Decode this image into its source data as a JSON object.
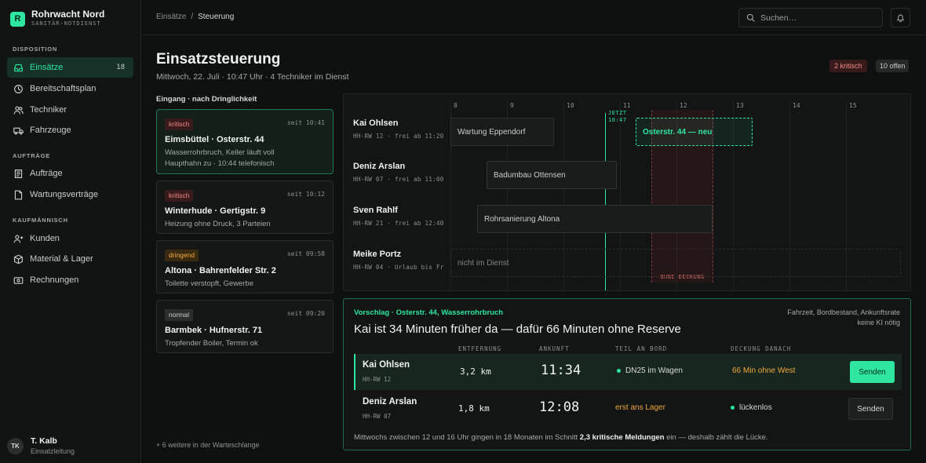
{
  "brand": {
    "initial": "R",
    "name": "Rohrwacht Nord",
    "subtitle": "SANITÄR-NOTDIENST"
  },
  "sidebar": {
    "sections": [
      {
        "label": "DISPOSITION"
      },
      {
        "label": "AUFTRÄGE"
      },
      {
        "label": "KAUFMÄNNISCH"
      }
    ],
    "items": [
      {
        "label": "Einsätze",
        "icon": "inbox-icon",
        "count": "18",
        "active": true
      },
      {
        "label": "Bereitschaftsplan",
        "icon": "clock-icon"
      },
      {
        "label": "Techniker",
        "icon": "users-icon"
      },
      {
        "label": "Fahrzeuge",
        "icon": "truck-icon"
      },
      {
        "label": "Aufträge",
        "icon": "document-icon"
      },
      {
        "label": "Wartungsverträge",
        "icon": "contract-icon"
      },
      {
        "label": "Kunden",
        "icon": "user-icon"
      },
      {
        "label": "Material & Lager",
        "icon": "box-icon"
      },
      {
        "label": "Rechnungen",
        "icon": "invoice-icon"
      }
    ],
    "user": {
      "initials": "TK",
      "name": "T. Kalb",
      "role": "Einsatzleitung"
    }
  },
  "topbar": {
    "breadcrumb": [
      "Einsätze",
      "/",
      "Steuerung"
    ],
    "search_placeholder": "Suchen…"
  },
  "header": {
    "title": "Einsatzsteuerung",
    "subtitle": "Mittwoch, 22. Juli · 10:47 Uhr · 4 Techniker im Dienst",
    "badge_critical": "2 kritisch",
    "badge_open": "10 offen"
  },
  "queue": {
    "label": "Eingang · nach Dringlichkeit",
    "cards": [
      {
        "tag": "kritisch",
        "time": "seit 10:41",
        "title": "Eimsbüttel · Osterstr. 44",
        "desc1": "Wasserrohrbruch, Keller läuft voll",
        "desc2": "Haupthahn zu · 10:44 telefonisch"
      },
      {
        "tag": "kritisch",
        "time": "seit 10:12",
        "title": "Winterhude · Gertigstr. 9",
        "desc1": "Heizung ohne Druck, 3 Parteien"
      },
      {
        "tag": "dringend",
        "time": "seit 09:58",
        "title": "Altona · Bahrenfelder Str. 2",
        "desc1": "Toilette verstopft, Gewerbe"
      },
      {
        "tag": "normal",
        "time": "seit 09:20",
        "title": "Barmbek · Hufnerstr. 71",
        "desc1": "Tropfender Boiler, Termin ok"
      }
    ],
    "more": "+ 6 weitere in der Warteschlange"
  },
  "timeline": {
    "hours": [
      "8",
      "9",
      "10",
      "11",
      "12",
      "13",
      "14",
      "15"
    ],
    "now_label1": "JETZT",
    "now_label2": "10:47",
    "gap_label": "OHNE DECKUNG",
    "rows": [
      {
        "name": "Kai Ohlsen",
        "meta": "HH-RW 12 · frei ab 11:20",
        "block": "Wartung Eppendorf",
        "new_block": "Osterstr. 44 — neu"
      },
      {
        "name": "Deniz Arslan",
        "meta": "HH-RW 07 · frei ab 11:00",
        "block": "Badumbau Ottensen"
      },
      {
        "name": "Sven Rahlf",
        "meta": "HH-RW 21 · frei ab 12:40",
        "block": "Rohrsanierung Altona"
      },
      {
        "name": "Meike Portz",
        "meta": "HH-RW 04 · Urlaub bis Fr",
        "block": "nicht im Dienst"
      }
    ]
  },
  "proposal": {
    "kicker": "Vorschlag · Osterstr. 44, Wasserrohrbruch",
    "title": "Kai ist 34 Minuten früher da — dafür 66 Minuten ohne Reserve",
    "note1": "Fahrzeit, Bordbestand, Ankunftsrate",
    "note2": "keine KI nötig",
    "columns": [
      "ENTFERNUNG",
      "ANKUNFT",
      "TEIL AN BORD",
      "DECKUNG DANACH"
    ],
    "rows": [
      {
        "name": "Kai Ohlsen",
        "plate": "HH-RW 12",
        "distance": "3,2 km",
        "eta": "11:34",
        "part": "DN25 im Wagen",
        "cover": "66 Min ohne West",
        "button": "Senden"
      },
      {
        "name": "Deniz Arslan",
        "plate": "HH-RW 07",
        "distance": "1,8 km",
        "eta": "12:08",
        "part": "erst ans Lager",
        "cover": "lückenlos",
        "button": "Senden"
      }
    ],
    "footer_a": "Mittwochs zwischen 12 und 16 Uhr gingen in 18 Monaten im Schnitt ",
    "footer_b": "2,3 kritische Meldungen",
    "footer_c": " ein — deshalb zählt die Lücke."
  },
  "colors": {
    "accent": "#2ee6a0",
    "critical": "#f08a86",
    "warning": "#f0a93a"
  }
}
